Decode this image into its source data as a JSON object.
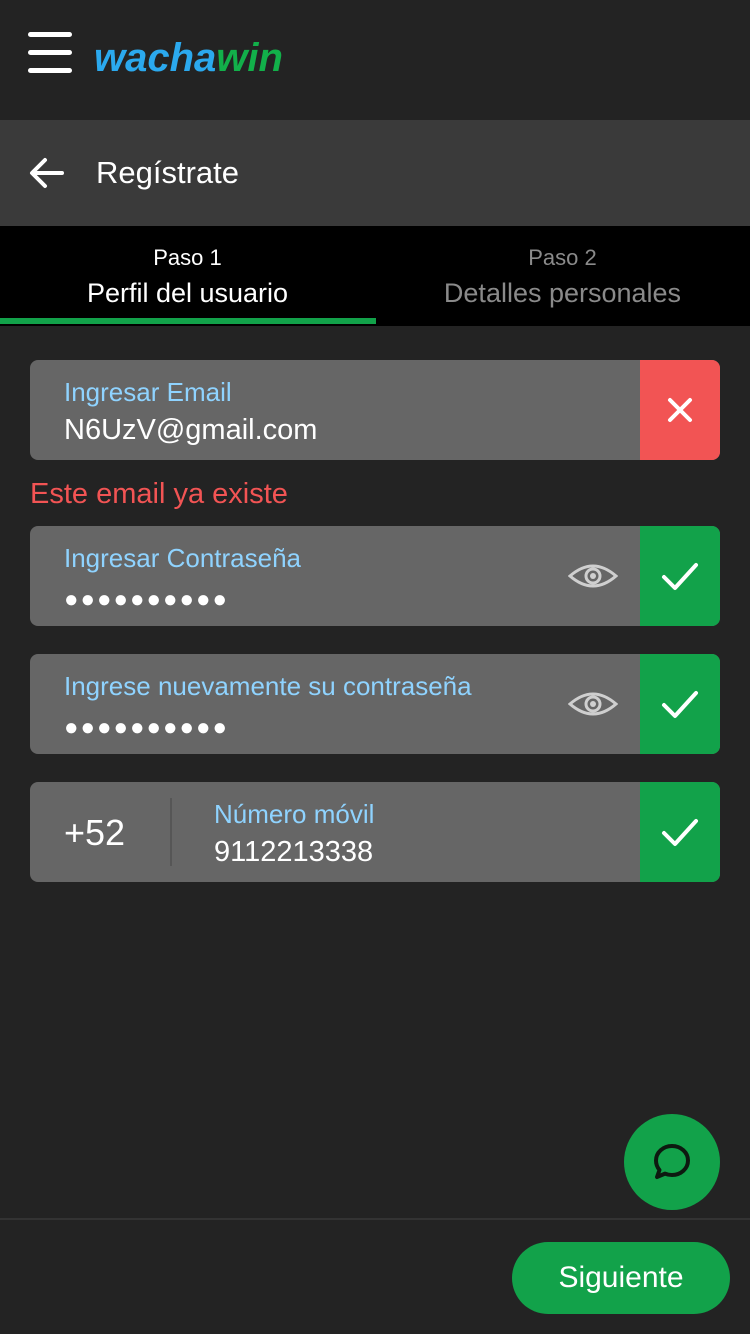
{
  "app": {
    "logo_part1": "wacha",
    "logo_part2": "win"
  },
  "header": {
    "title": "Regístrate"
  },
  "steps": [
    {
      "num": "Paso 1",
      "label": "Perfil del usuario",
      "active": true
    },
    {
      "num": "Paso 2",
      "label": "Detalles personales",
      "active": false
    }
  ],
  "form": {
    "email": {
      "label": "Ingresar Email",
      "value": "N6UzV@gmail.com",
      "status": "error"
    },
    "email_error": "Este email ya existe",
    "password": {
      "label": "Ingresar Contraseña",
      "value": "●●●●●●●●●●",
      "status": "ok"
    },
    "password_confirm": {
      "label": "Ingrese nuevamente su contraseña",
      "value": "●●●●●●●●●●",
      "status": "ok"
    },
    "phone": {
      "prefix": "+52",
      "label": "Número móvil",
      "value": "9112213338",
      "status": "ok"
    }
  },
  "footer": {
    "next_label": "Siguiente"
  },
  "colors": {
    "brand_blue": "#2ba9ee",
    "brand_green": "#12b04a",
    "accent_green": "#12a24a",
    "error_red": "#f25454",
    "label_blue": "#8fd3ff"
  },
  "icons": {
    "menu": "hamburger-menu-icon",
    "back": "arrow-left-icon",
    "error": "close-icon",
    "ok": "check-icon",
    "show_password": "eye-icon",
    "chat": "chat-bubble-icon"
  }
}
